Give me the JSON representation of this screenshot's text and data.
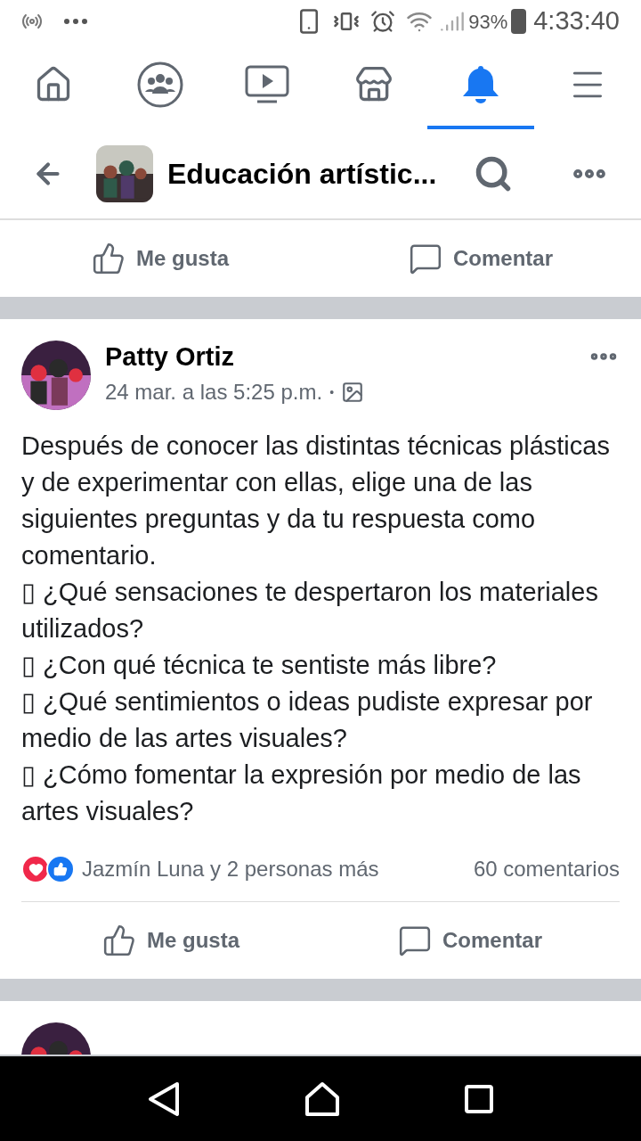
{
  "status_bar": {
    "battery": "93%",
    "time": "4:33:40"
  },
  "nav_tabs": [
    {
      "kind": "home",
      "selected": false
    },
    {
      "kind": "groups",
      "selected": false
    },
    {
      "kind": "watch",
      "selected": false
    },
    {
      "kind": "marketplace",
      "selected": false
    },
    {
      "kind": "notifications",
      "selected": true
    },
    {
      "kind": "menu",
      "selected": false
    }
  ],
  "header": {
    "title": "Educación artístic..."
  },
  "top_actions": [
    "Me gusta",
    "Comentar"
  ],
  "post": {
    "author": "Patty Ortiz",
    "time": "24 mar. a las 5:25 p.m.",
    "audience_separator": "•",
    "body": [
      "Después de conocer las distintas técnicas plásticas y de experimentar con ellas, elige una de las siguientes preguntas y da tu respuesta como comentario.",
      "▯ ¿Qué sensaciones te despertaron los materiales utilizados?",
      "▯ ¿Con qué técnica te sentiste más libre?",
      "▯ ¿Qué sentimientos o ideas pudiste expresar por medio de las artes visuales?",
      "▯ ¿Cómo fomentar la expresión por medio de las artes visuales?"
    ],
    "reactions": [
      {
        "kind": "love"
      },
      {
        "kind": "like"
      }
    ],
    "reactors": "Jazmín Luna y 2 personas más",
    "comments": "60 comentarios",
    "actions": [
      "Me gusta",
      "Comentar"
    ]
  }
}
